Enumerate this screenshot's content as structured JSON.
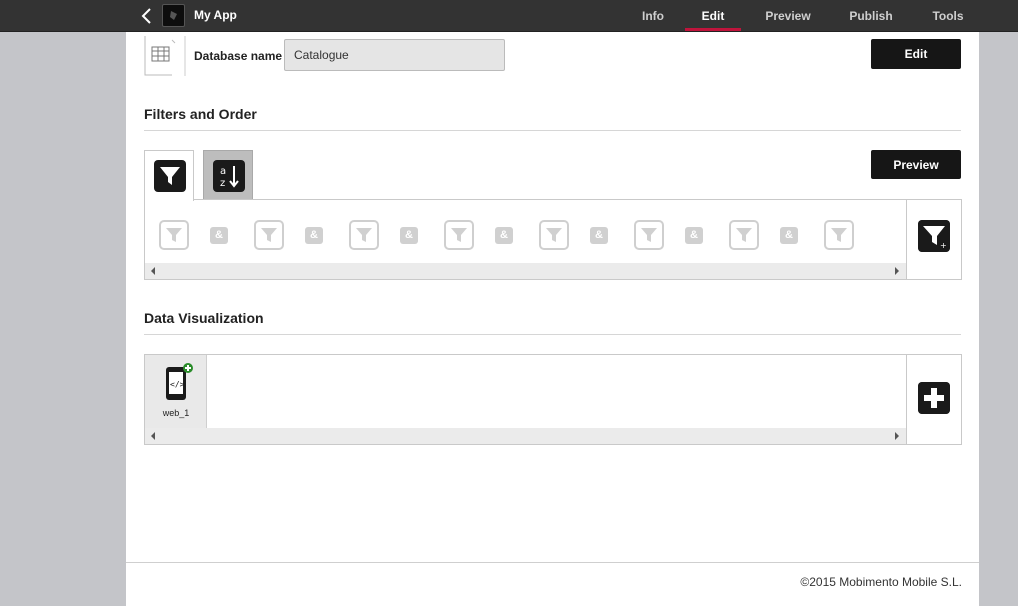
{
  "header": {
    "app_title": "My App",
    "back_icon": "chevron-left-icon",
    "nav": [
      {
        "label": "Info",
        "active": false
      },
      {
        "label": "Edit",
        "active": true
      },
      {
        "label": "Preview",
        "active": false
      },
      {
        "label": "Publish",
        "active": false
      },
      {
        "label": "Tools",
        "active": false
      }
    ],
    "accent": "#c0143c"
  },
  "database": {
    "label": "Database name",
    "value": "Catalogue",
    "edit_label": "Edit"
  },
  "filters": {
    "title": "Filters and Order",
    "preview_label": "Preview",
    "tabs": [
      "filter-icon",
      "sort-az-icon"
    ],
    "slots": [
      "filter",
      "and",
      "filter",
      "and",
      "filter",
      "and",
      "filter",
      "and",
      "filter",
      "and",
      "filter",
      "and",
      "filter",
      "and",
      "filter"
    ],
    "and_glyph": "&",
    "add_icon": "add-filter-icon"
  },
  "visualization": {
    "title": "Data Visualization",
    "items": [
      {
        "label": "web_1",
        "icon": "mobile-code-icon",
        "badge": "plus"
      }
    ],
    "add_icon": "plus-icon"
  },
  "footer": {
    "copyright": "©2015 Mobimento Mobile S.L."
  }
}
